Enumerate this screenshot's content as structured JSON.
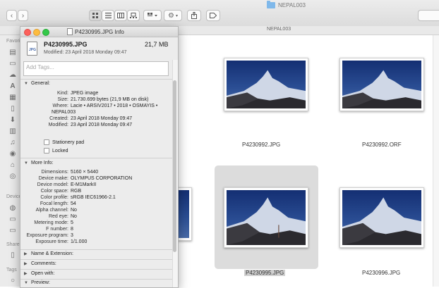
{
  "finder": {
    "title": "NEPAL003",
    "path": "NEPAL003",
    "toolbar": {
      "back": "‹",
      "forward": "›",
      "view_icon": "icon-view-icon",
      "view_list": "list-view-icon",
      "view_columns": "column-view-icon",
      "view_gallery": "gallery-view-icon",
      "arrange": "arrange-icon",
      "action": "gear-icon",
      "share": "share-icon",
      "tags": "tag-icon"
    },
    "sidebar": {
      "favorites_label": "Favori",
      "devices_label": "Device",
      "shared_label": "Share",
      "tags_label": "Tags"
    },
    "files": [
      {
        "name": "P4230992.JPG",
        "selected": false
      },
      {
        "name": "P4230992.ORF",
        "selected": false
      },
      {
        "name": "P4230995.JPG",
        "selected": true
      },
      {
        "name": "P4230996.JPG",
        "selected": false
      }
    ]
  },
  "info": {
    "window_title": "P4230995.JPG Info",
    "file_name": "P4230995.JPG",
    "file_size": "21,7 MB",
    "modified_header": "Modified: 23 April 2018 Monday 09:47",
    "tags_placeholder": "Add Tags...",
    "general": {
      "header": "General:",
      "kind_label": "Kind:",
      "kind": "JPEG image",
      "size_label": "Size:",
      "size": "21.730.699 bytes (21,9 MB on disk)",
      "where_label": "Where:",
      "where1": "Lacie • ARSIV2017 • 2018 • OSMAYIS •",
      "where2": "NEPAL003",
      "created_label": "Created:",
      "created": "23 April 2018 Monday 09:47",
      "modified_label": "Modified:",
      "modified": "23 April 2018 Monday 09:47",
      "stationery": "Stationery pad",
      "locked": "Locked"
    },
    "more_info": {
      "header": "More Info:",
      "rows": [
        {
          "label": "Dimensions:",
          "value": "5160 × 5440"
        },
        {
          "label": "Device make:",
          "value": "OLYMPUS CORPORATION"
        },
        {
          "label": "Device model:",
          "value": "E-M1MarkII"
        },
        {
          "label": "Color space:",
          "value": "RGB"
        },
        {
          "label": "Color profile:",
          "value": "sRGB IEC61966-2.1"
        },
        {
          "label": "Focal length:",
          "value": "54"
        },
        {
          "label": "Alpha channel:",
          "value": "No"
        },
        {
          "label": "Red eye:",
          "value": "No"
        },
        {
          "label": "Metering mode:",
          "value": "5"
        },
        {
          "label": "F number:",
          "value": "8"
        },
        {
          "label": "Exposure program:",
          "value": "3"
        },
        {
          "label": "Exposure time:",
          "value": "1/1.000"
        }
      ]
    },
    "name_ext": "Name & Extension:",
    "comments": "Comments:",
    "open_with": "Open with:",
    "preview": "Preview:"
  }
}
